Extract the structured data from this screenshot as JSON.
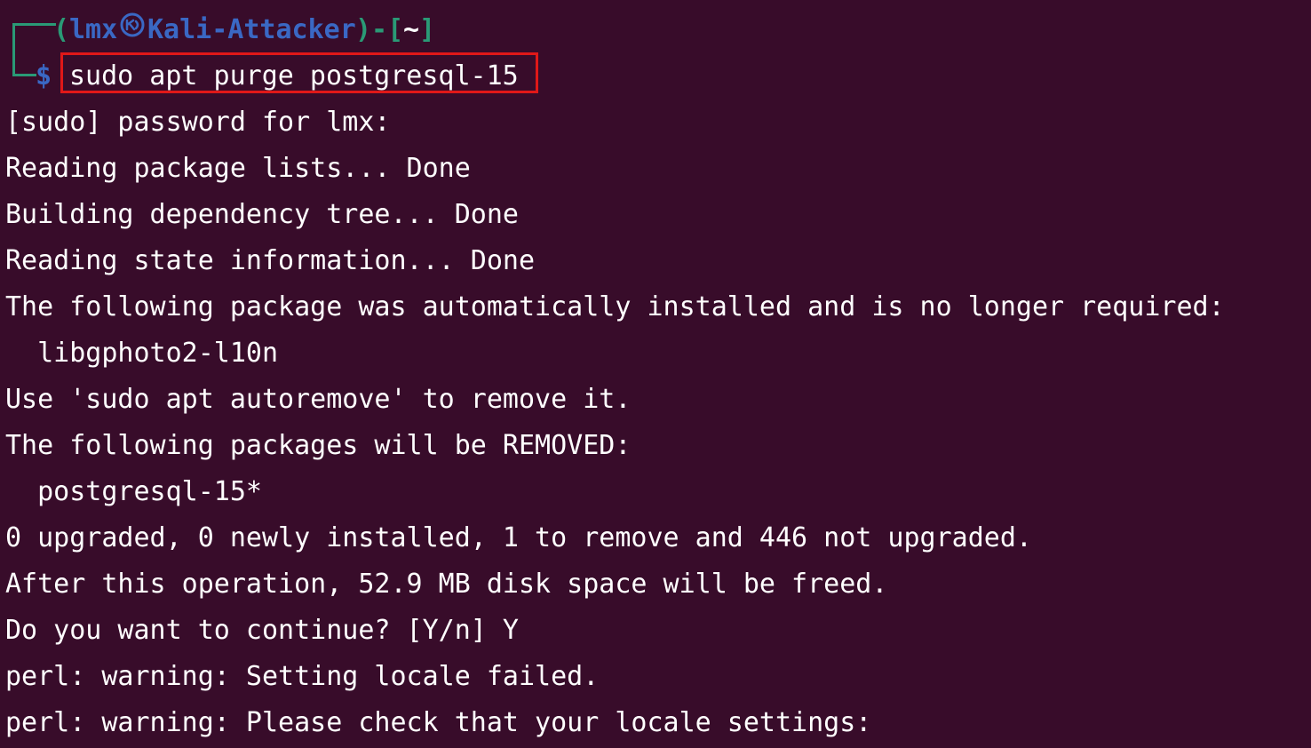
{
  "prompt": {
    "open_paren": "(",
    "user": "lmx",
    "host": "Kali-Attacker",
    "close_paren": ")-[",
    "path": "~",
    "close_bracket": "]",
    "symbol": "$",
    "command": "sudo apt purge postgresql-15"
  },
  "colors": {
    "background": "#380c2a",
    "prompt_frame": "#2a9a76",
    "prompt_user": "#3a68c4",
    "highlight_box": "#e01818",
    "text": "#ffffff"
  },
  "output_lines": [
    "[sudo] password for lmx:",
    "Reading package lists... Done",
    "Building dependency tree... Done",
    "Reading state information... Done",
    "The following package was automatically installed and is no longer required:",
    "  libgphoto2-l10n",
    "Use 'sudo apt autoremove' to remove it.",
    "The following packages will be REMOVED:",
    "  postgresql-15*",
    "0 upgraded, 0 newly installed, 1 to remove and 446 not upgraded.",
    "After this operation, 52.9 MB disk space will be freed.",
    "Do you want to continue? [Y/n] Y",
    "perl: warning: Setting locale failed.",
    "perl: warning: Please check that your locale settings:"
  ]
}
